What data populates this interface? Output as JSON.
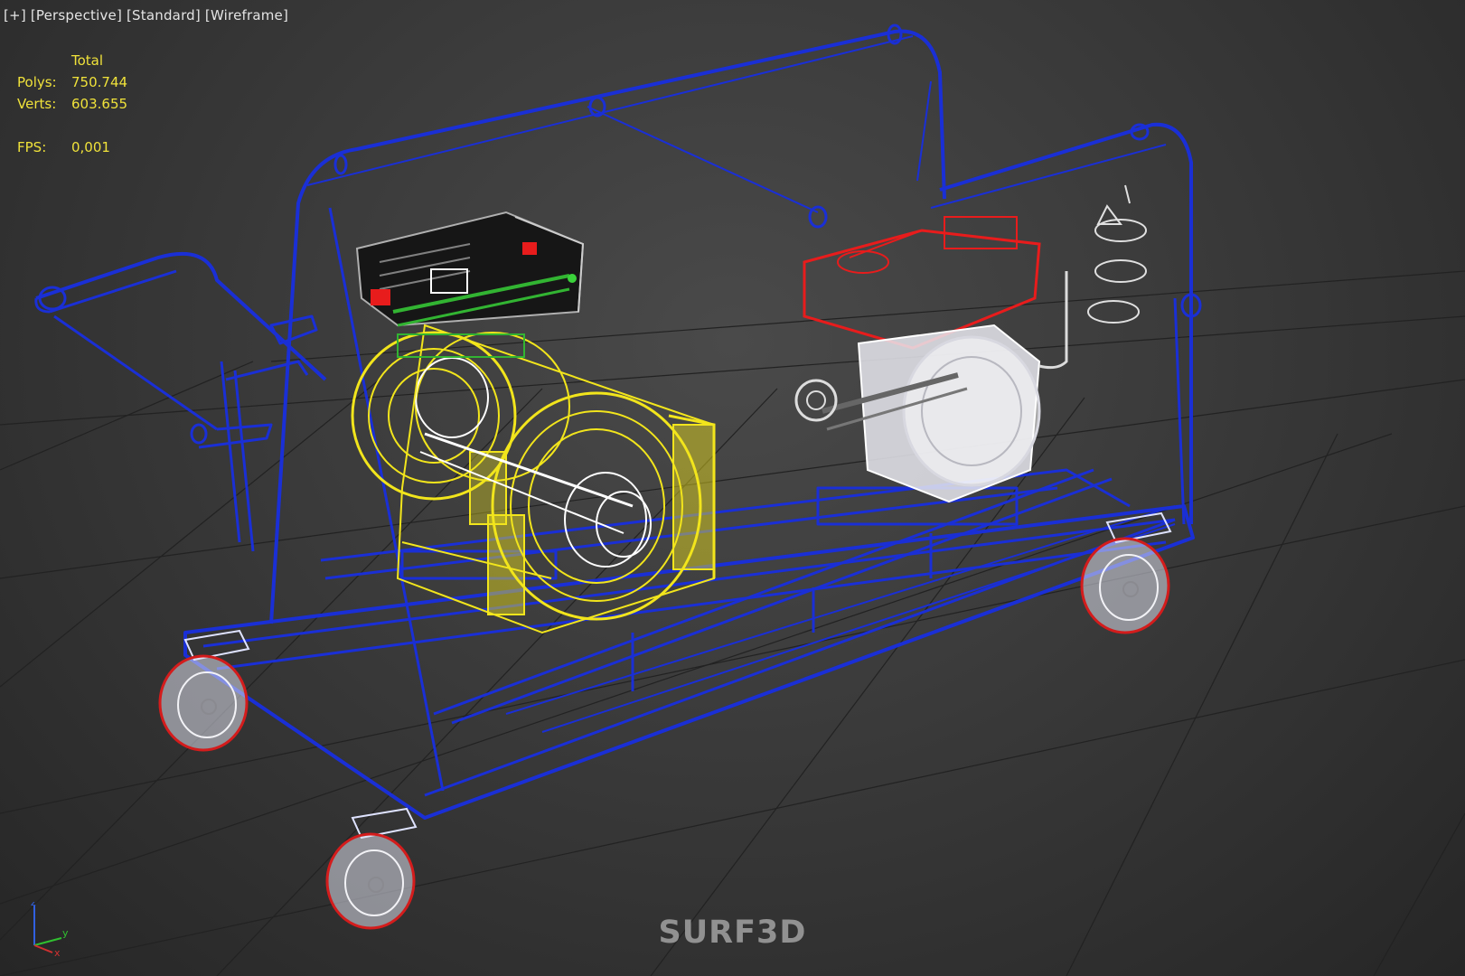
{
  "viewport_menu": {
    "plus": "[+]",
    "view": "[Perspective]",
    "shading_style": "[Standard]",
    "render_mode": "[Wireframe]"
  },
  "stats": {
    "header": "Total",
    "polys_label": "Polys:",
    "polys_value": "750.744",
    "verts_label": "Verts:",
    "verts_value": "603.655",
    "fps_label": "FPS:",
    "fps_value": "0,001"
  },
  "watermark": "SURF3D",
  "axis": {
    "x": "x",
    "y": "y",
    "z": "z"
  },
  "colors": {
    "background": "#3a3a3a",
    "grid": "#222222",
    "frame_wireframe": "#1a2fd6",
    "generator_wireframe": "#f2e51c",
    "engine_wireframe": "#e81c1c",
    "engine_body": "#e8e8ee",
    "control_box": "#161616",
    "stats_text": "#f0e23a",
    "menu_text": "#e4e4e4",
    "axis_x": "#d03030",
    "axis_y": "#30c030",
    "axis_z": "#3060e0"
  },
  "objects": [
    "caster-wheel",
    "steel-frame",
    "generator",
    "diesel-engine",
    "control-box",
    "exhaust-pipe",
    "belt-pulley"
  ]
}
